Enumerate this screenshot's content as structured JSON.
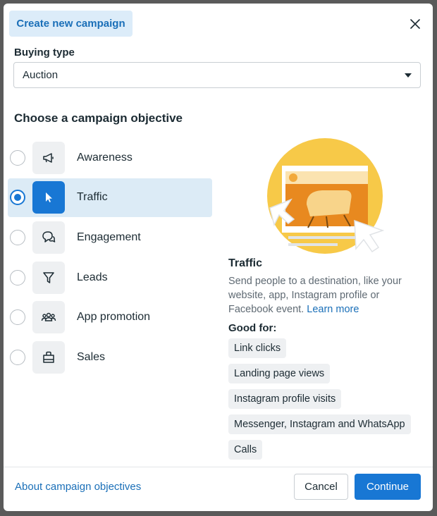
{
  "header": {
    "title": "Create new campaign"
  },
  "buying_type": {
    "label": "Buying type",
    "value": "Auction"
  },
  "objectives_section": {
    "title": "Choose a campaign objective"
  },
  "objectives": [
    {
      "label": "Awareness",
      "icon": "megaphone-icon",
      "selected": false
    },
    {
      "label": "Traffic",
      "icon": "cursor-icon",
      "selected": true
    },
    {
      "label": "Engagement",
      "icon": "chat-bubbles-icon",
      "selected": false
    },
    {
      "label": "Leads",
      "icon": "funnel-icon",
      "selected": false
    },
    {
      "label": "App promotion",
      "icon": "people-icon",
      "selected": false
    },
    {
      "label": "Sales",
      "icon": "shopping-bag-icon",
      "selected": false
    }
  ],
  "detail": {
    "title": "Traffic",
    "description": "Send people to a destination, like your website, app, Instagram profile or Facebook event.",
    "learn_more": "Learn more",
    "good_for_label": "Good for:",
    "good_for": [
      "Link clicks",
      "Landing page views",
      "Instagram profile visits",
      "Messenger, Instagram and WhatsApp",
      "Calls"
    ]
  },
  "footer": {
    "link": "About campaign objectives",
    "cancel": "Cancel",
    "continue": "Continue"
  },
  "colors": {
    "accent": "#1877d4",
    "link": "#1a6fb8",
    "selected_bg": "#dcebf6",
    "illustration_yellow": "#f7c948",
    "illustration_orange": "#e8891f"
  }
}
